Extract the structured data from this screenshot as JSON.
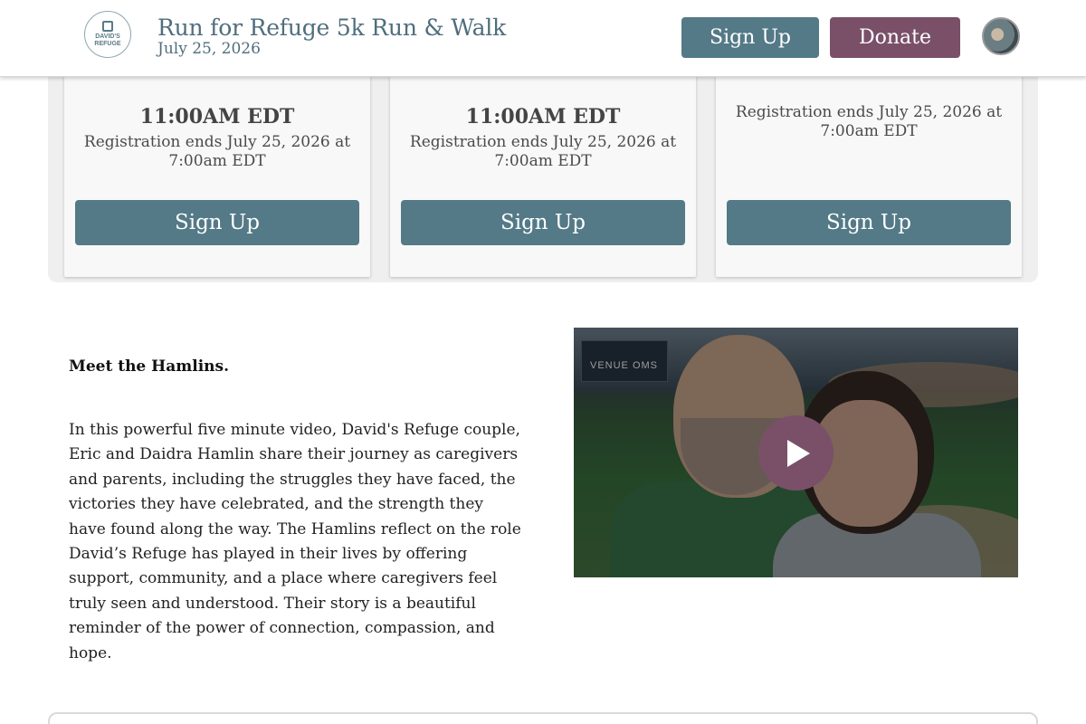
{
  "header": {
    "logo_text": "DAVID'S REFUGE",
    "title": "Run for Refuge 5k Run & Walk",
    "date": "July 25, 2026",
    "signup_label": "Sign Up",
    "donate_label": "Donate"
  },
  "registration": {
    "cards": [
      {
        "time": "11:00AM EDT",
        "reg_text": "Registration ends July 25, 2026 at 7:00am EDT",
        "button": "Sign Up"
      },
      {
        "time": "11:00AM EDT",
        "reg_text": "Registration ends July 25, 2026 at 7:00am EDT",
        "button": "Sign Up"
      },
      {
        "time": "",
        "reg_text": "Registration ends July 25, 2026 at 7:00am EDT",
        "button": "Sign Up"
      }
    ]
  },
  "story": {
    "heading": "Meet the Hamlins.",
    "body": "In this powerful five minute video, David's Refuge couple, Eric and Daidra Hamlin share their journey as caregivers and parents, including the struggles they have faced, the victories they have celebrated, and the strength they have found along the way. The Hamlins reflect on the role David’s Refuge has played in their lives by offering support, community, and a place where caregivers feel truly seen and understood. Their story is a beautiful reminder of the power of connection, compassion, and hope.",
    "video": {
      "scoreboard_text": "VENUE OMS",
      "play_icon": "play-icon"
    }
  },
  "colors": {
    "primary": "#547987",
    "donate": "#7a5069",
    "title": "#4f6e7d",
    "panel_bg": "#efefef"
  }
}
